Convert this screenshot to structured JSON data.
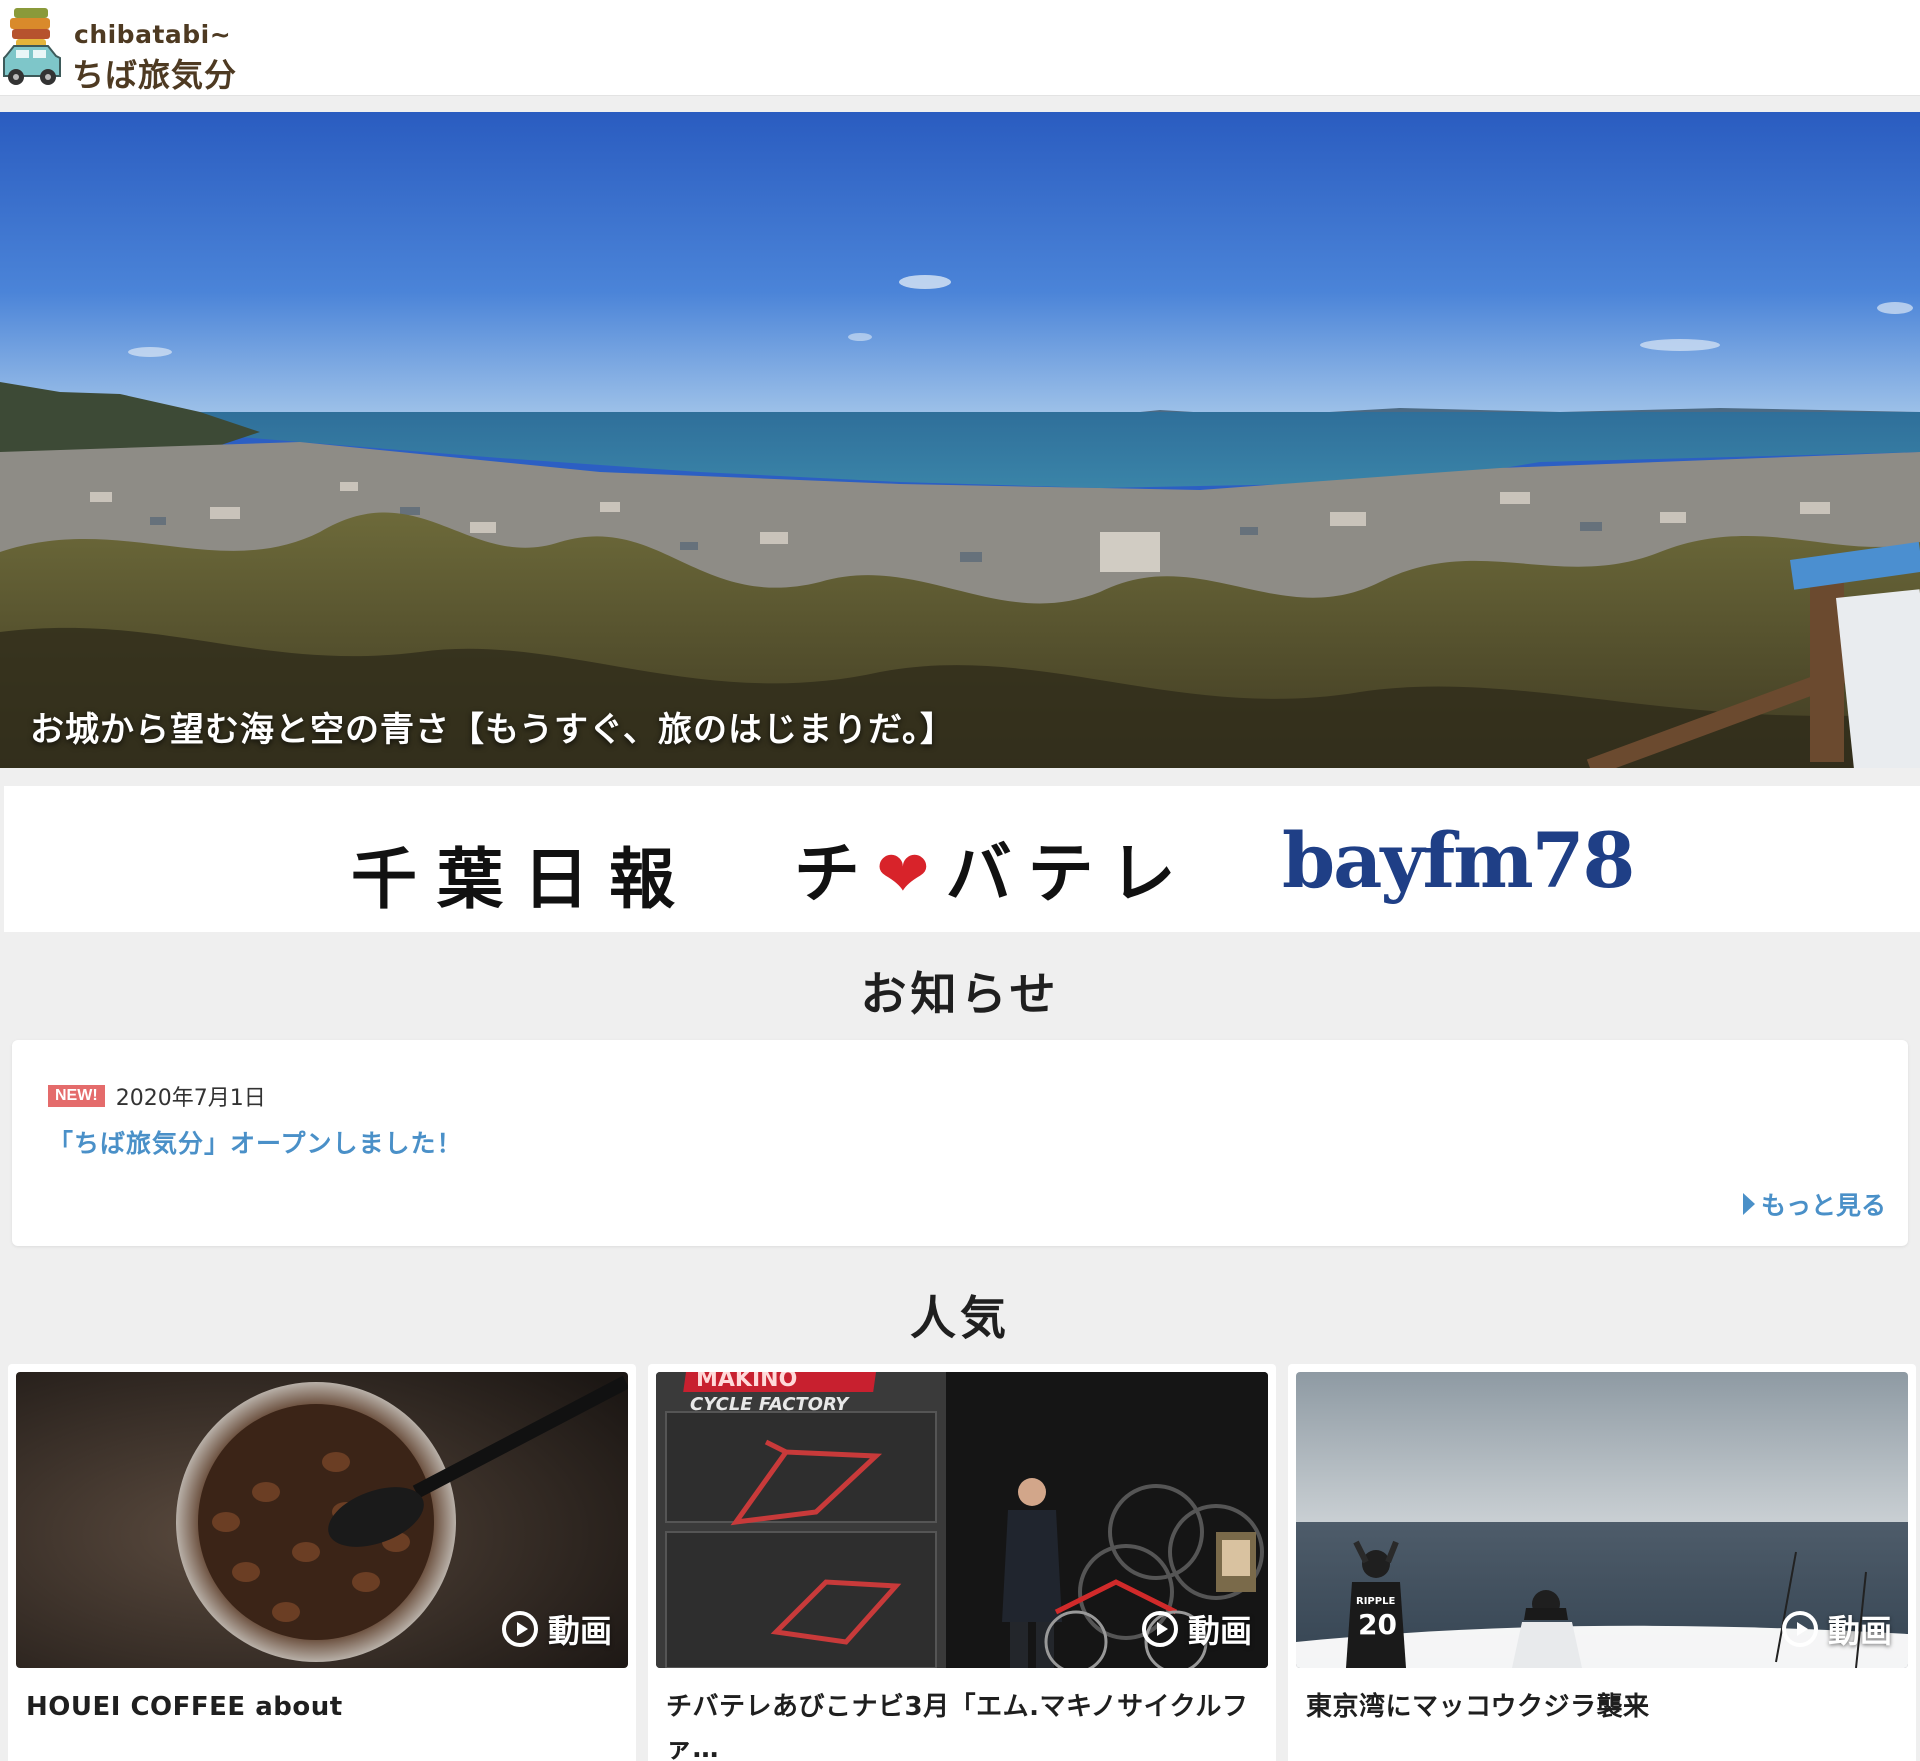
{
  "header": {
    "logo_sub": "chibatabi~",
    "logo_main": "ちば旅気分"
  },
  "hero": {
    "caption": "お城から望む海と空の青さ【もうすぐ、旅のはじまりだ。】"
  },
  "partners": [
    {
      "label": "千葉日報"
    },
    {
      "label_pre": "チ",
      "label_heart": "❤",
      "label_post": "バテレ"
    },
    {
      "label": "bayfm78"
    }
  ],
  "news": {
    "title": "お知らせ",
    "items": [
      {
        "badge": "NEW!",
        "date": "2020年7月1日",
        "headline": "「ちば旅気分」オープンしました！"
      }
    ],
    "more_label": "もっと見る"
  },
  "popular": {
    "title": "人気",
    "cards": [
      {
        "badge": "動画",
        "title": "HOUEI COFFEE about"
      },
      {
        "badge": "動画",
        "title": "チバテレあびこナビ3月「エム.マキノサイクルファ…",
        "thumb_sign_top": "MAKINO",
        "thumb_sign": "CYCLE FACTORY"
      },
      {
        "badge": "動画",
        "title": "東京湾にマッコウクジラ襲来",
        "thumb_shirt": "20",
        "thumb_shirt_brand": "RIPPLE"
      }
    ]
  },
  "colors": {
    "link": "#4a90c8",
    "badge_new": "#e46b6b",
    "bayfm": "#1f3f86",
    "logo_brown": "#4e3a22"
  }
}
